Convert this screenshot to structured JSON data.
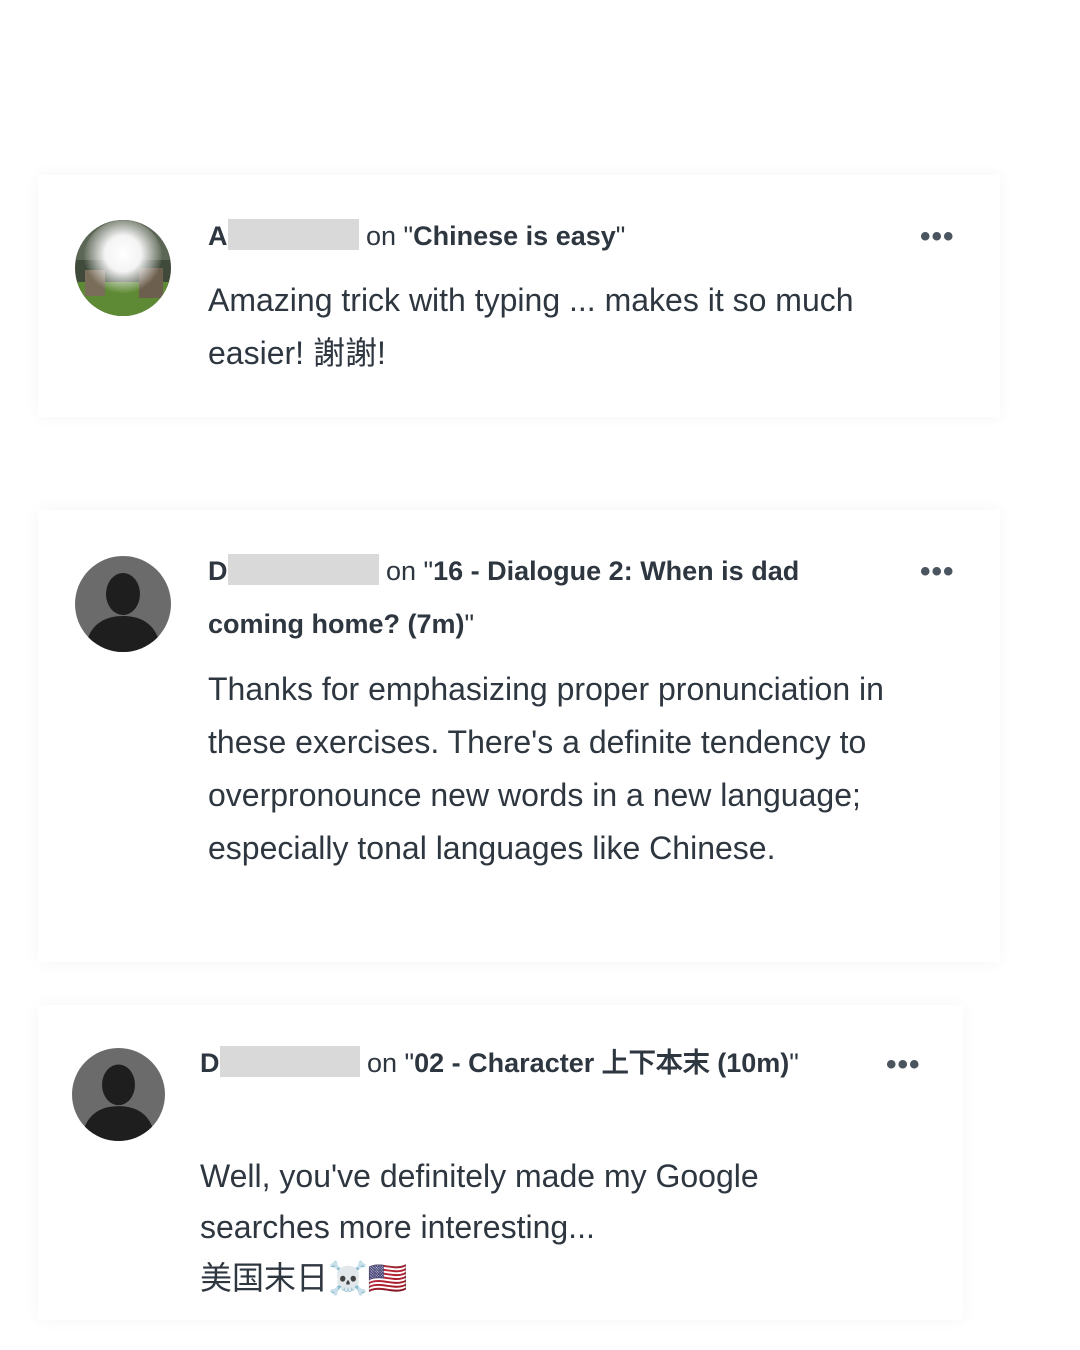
{
  "comments": [
    {
      "author_initial": "A",
      "on_text": "on \"",
      "post_title": "Chinese is easy",
      "close_quote": "\"",
      "body": "Amazing trick with typing ... makes it so much easier! 謝謝!",
      "more_label": "•••",
      "avatar_icon": "user-photo-avatar"
    },
    {
      "author_initial": "D",
      "on_text": "on \"",
      "post_title": "16 - Dialogue 2: When is dad coming home? (7m)",
      "close_quote": "\"",
      "body": "Thanks for emphasizing proper pronunciation in these exercises. There's a definite tendency to overpronounce new words in a new language; especially tonal languages like Chinese.",
      "more_label": "•••",
      "avatar_icon": "default-user-avatar"
    },
    {
      "author_initial": "D",
      "on_text": "on \"",
      "post_title": "02 - Character 上下本末 (10m)",
      "close_quote": "\"",
      "body": "Well, you've definitely made my Google searches more interesting...\n美国末日☠️🇺🇸",
      "more_label": "•••",
      "avatar_icon": "default-user-avatar"
    }
  ]
}
